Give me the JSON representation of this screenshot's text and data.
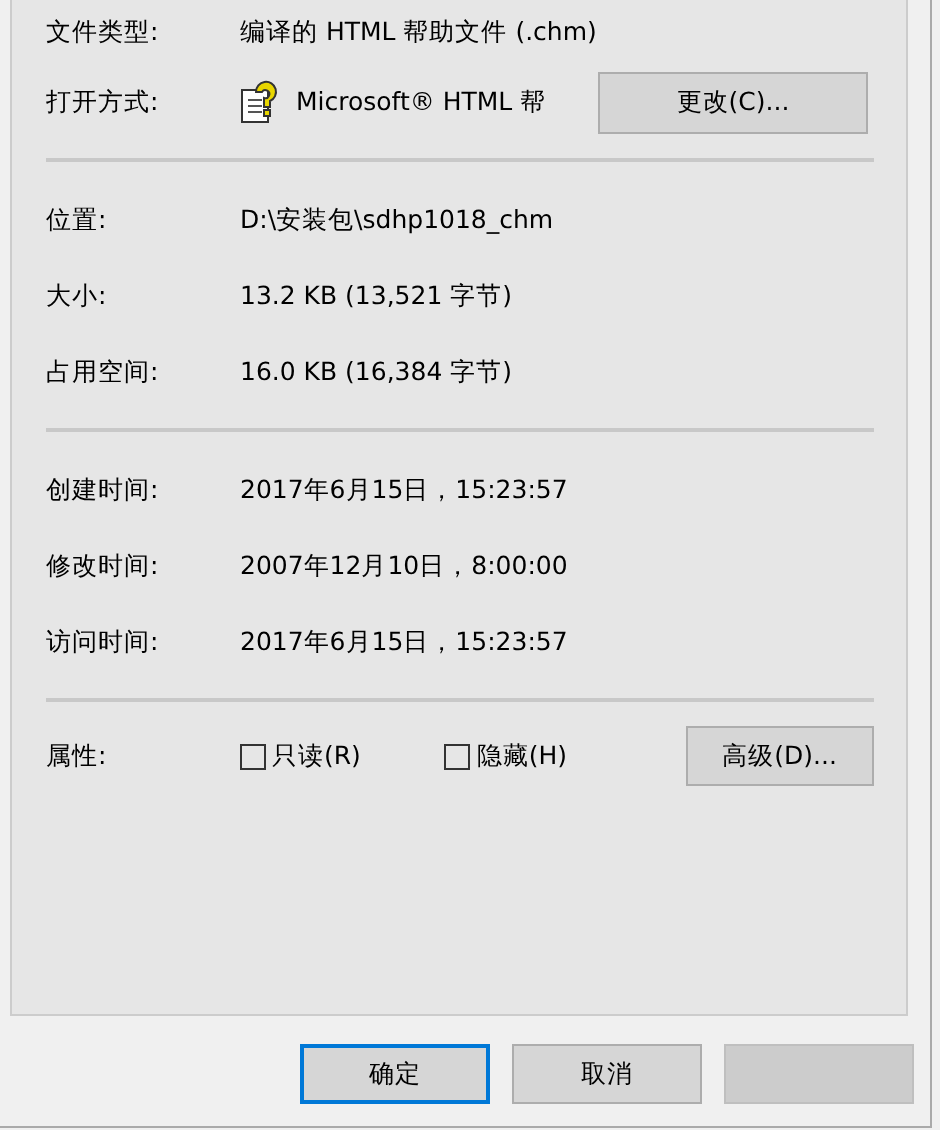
{
  "details": [
    {
      "kind": "text",
      "label": "文件类型:",
      "value": "编译的 HTML 帮助文件 (.chm)"
    },
    {
      "kind": "app",
      "label": "打开方式:",
      "value": "Microsoft® HTML 帮",
      "button": "更改(C)..."
    },
    {
      "kind": "separator"
    },
    {
      "kind": "text",
      "label": "位置:",
      "value": "D:\\安装包\\sdhp1018_chm"
    },
    {
      "kind": "text",
      "label": "大小:",
      "value": "13.2 KB (13,521 字节)"
    },
    {
      "kind": "text",
      "label": "占用空间:",
      "value": "16.0 KB (16,384 字节)"
    },
    {
      "kind": "separator"
    },
    {
      "kind": "text",
      "label": "创建时间:",
      "value": "2017年6月15日，15:23:57"
    },
    {
      "kind": "text",
      "label": "修改时间:",
      "value": "2007年12月10日，8:00:00"
    },
    {
      "kind": "text",
      "label": "访问时间:",
      "value": "2017年6月15日，15:23:57"
    },
    {
      "kind": "separator"
    }
  ],
  "attributes": {
    "label": "属性:",
    "checkboxes": [
      {
        "label": "只读(R)",
        "checked": false
      },
      {
        "label": "隐藏(H)",
        "checked": false
      }
    ],
    "button": "高级(D)..."
  },
  "buttons": [
    {
      "label": "确定",
      "default": true,
      "disabled": false
    },
    {
      "label": "取消",
      "default": false,
      "disabled": false
    },
    {
      "default": false,
      "disabled": true
    }
  ]
}
